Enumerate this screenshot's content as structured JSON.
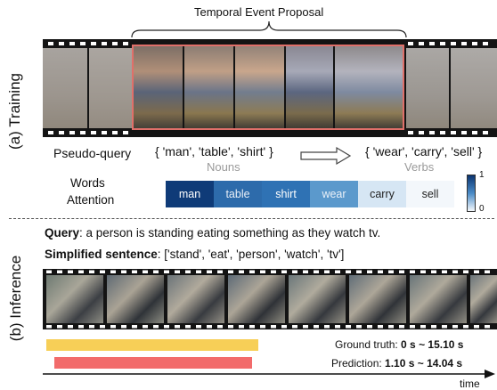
{
  "title": "Temporal Event Proposal",
  "training": {
    "section_label": "(a) Training",
    "pseudo_query_label": "Pseudo-query",
    "nouns_set": "{ 'man', 'table', 'shirt' }",
    "nouns_caption": "Nouns",
    "verbs_set": "{ 'wear', 'carry', 'sell' }",
    "verbs_caption": "Verbs",
    "attention_label_line1": "Words",
    "attention_label_line2": "Attention",
    "words": [
      {
        "text": "man",
        "bg": "#0f3b78",
        "fg": "#ffffff"
      },
      {
        "text": "table",
        "bg": "#2d6bab",
        "fg": "#e8eef6"
      },
      {
        "text": "shirt",
        "bg": "#2f72b4",
        "fg": "#ffffff"
      },
      {
        "text": "wear",
        "bg": "#5b99cc",
        "fg": "#e9f0f8"
      },
      {
        "text": "carry",
        "bg": "#d6e6f4",
        "fg": "#222222"
      },
      {
        "text": "sell",
        "bg": "#f3f7fb",
        "fg": "#222222"
      }
    ],
    "colorbar_max": "1",
    "colorbar_min": "0",
    "proposal_border": "#e0706a"
  },
  "inference": {
    "section_label": "(b) Inference",
    "query_label": "Query",
    "query_text": ":  a person is standing eating something as they watch tv.",
    "simplified_label": "Simplified sentence",
    "simplified_text": ":  ['stand', 'eat', 'person', 'watch', 'tv']",
    "ground_truth_label": "Ground truth: ",
    "ground_truth_value": "0 s ~ 15.10 s",
    "ground_truth_color": "#f7cf57",
    "prediction_label": "Prediction: ",
    "prediction_value": "1.10 s ~ 14.04 s",
    "prediction_color": "#f26b6b",
    "time_label": "time"
  }
}
